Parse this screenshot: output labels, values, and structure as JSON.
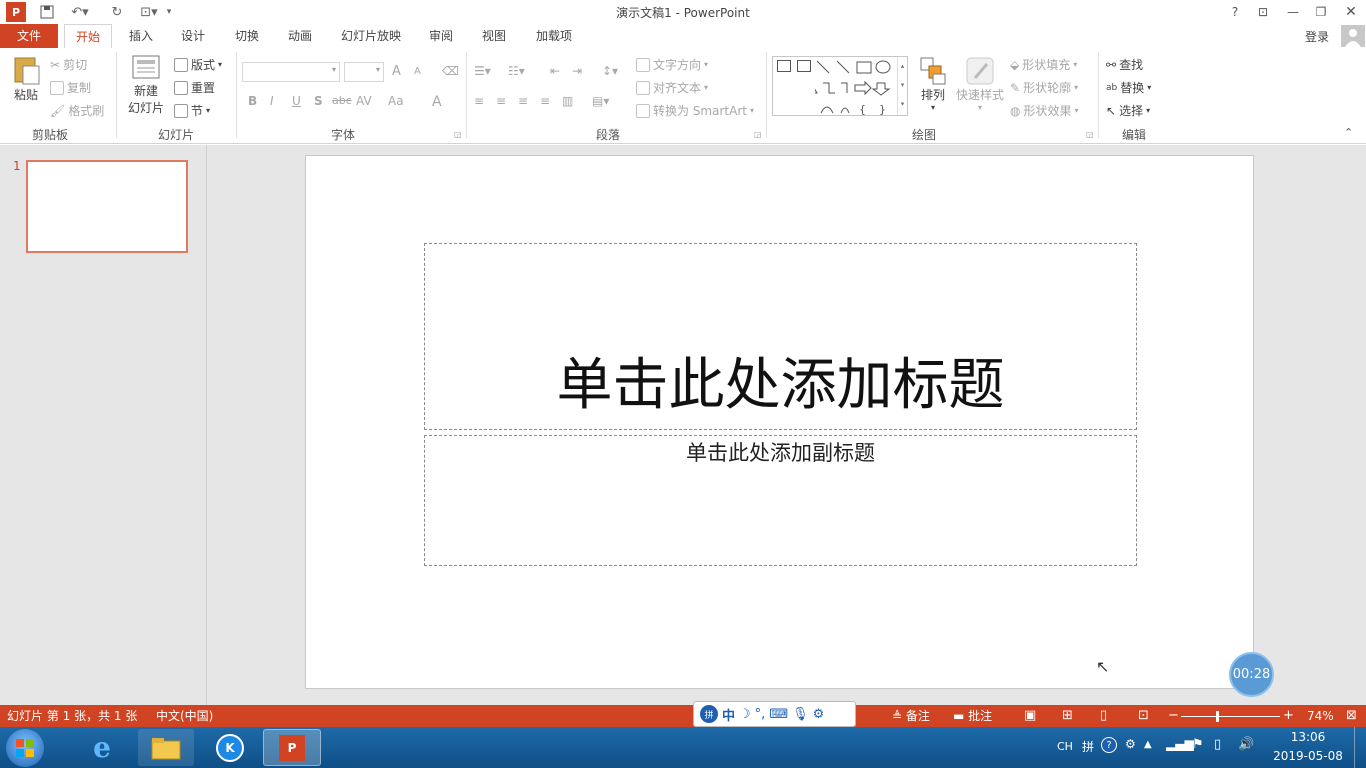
{
  "window": {
    "title": "演示文稿1 - PowerPoint",
    "login": "登录"
  },
  "tabs": [
    "文件",
    "开始",
    "插入",
    "设计",
    "切换",
    "动画",
    "幻灯片放映",
    "审阅",
    "视图",
    "加载项"
  ],
  "ribbon": {
    "clipboard": {
      "paste": "粘贴",
      "cut": "剪切",
      "copy": "复制",
      "format_painter": "格式刷",
      "label": "剪贴板"
    },
    "slides": {
      "new_slide_1": "新建",
      "new_slide_2": "幻灯片",
      "layout": "版式",
      "reset": "重置",
      "section": "节",
      "label": "幻灯片"
    },
    "font": {
      "label": "字体",
      "bold": "B",
      "italic": "I",
      "underline": "U",
      "shadow": "S",
      "strike": "abc",
      "spacing": "AV",
      "case": "Aa",
      "color": "A",
      "grow": "A",
      "shrink": "A"
    },
    "paragraph": {
      "text_direction": "文字方向",
      "align_text": "对齐文本",
      "smartart": "转换为 SmartArt",
      "label": "段落"
    },
    "drawing": {
      "arrange": "排列",
      "quick_styles": "快速样式",
      "shape_fill": "形状填充",
      "shape_outline": "形状轮廓",
      "shape_effects": "形状效果",
      "label": "绘图"
    },
    "editing": {
      "find": "查找",
      "replace": "替换",
      "select": "选择",
      "label": "编辑"
    }
  },
  "slide": {
    "number": "1",
    "title_placeholder": "单击此处添加标题",
    "subtitle_placeholder": "单击此处添加副标题"
  },
  "timer": "00:28",
  "status": {
    "slide_info": "幻灯片 第 1 张，共 1 张",
    "language": "中文(中国)",
    "notes": "备注",
    "comments": "批注",
    "zoom": "74%"
  },
  "ime": {
    "mode": "中"
  },
  "taskbar": {
    "lang": "CH",
    "time": "13:06",
    "date": "2019-05-08"
  },
  "colors": {
    "accent": "#d04423",
    "thumb_border": "#e07a5f",
    "taskbar": "#1a5f9c"
  }
}
